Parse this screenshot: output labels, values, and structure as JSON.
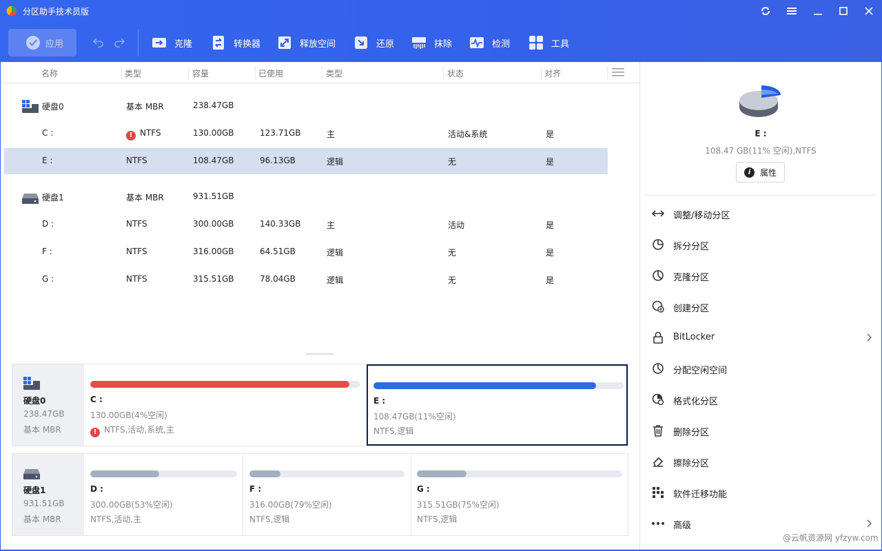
{
  "app": {
    "title": "分区助手技术员版",
    "accent_color": "#3561ea"
  },
  "toolbar": {
    "apply_label": "应用",
    "items": [
      {
        "label": "克隆",
        "icon": "clone-icon"
      },
      {
        "label": "转换器",
        "icon": "convert-icon"
      },
      {
        "label": "释放空间",
        "icon": "free-space-icon"
      },
      {
        "label": "还原",
        "icon": "restore-icon"
      },
      {
        "label": "抹除",
        "icon": "wipe-icon"
      },
      {
        "label": "检测",
        "icon": "check-icon"
      },
      {
        "label": "工具",
        "icon": "tools-icon"
      }
    ]
  },
  "table": {
    "columns": [
      "名称",
      "类型",
      "容量",
      "已使用",
      "类型",
      "状态",
      "对齐"
    ],
    "disks": [
      {
        "name": "硬盘0",
        "type": "基本 MBR",
        "capacity": "238.47GB",
        "partitions": [
          {
            "name": "C :",
            "fs": "NTFS",
            "warning": true,
            "capacity": "130.00GB",
            "used": "123.71GB",
            "kind": "主",
            "status": "活动&系统",
            "aligned": "是"
          },
          {
            "name": "E :",
            "fs": "NTFS",
            "warning": false,
            "capacity": "108.47GB",
            "used": "96.13GB",
            "kind": "逻辑",
            "status": "无",
            "aligned": "是",
            "selected": true
          }
        ]
      },
      {
        "name": "硬盘1",
        "type": "基本 MBR",
        "capacity": "931.51GB",
        "partitions": [
          {
            "name": "D :",
            "fs": "NTFS",
            "capacity": "300.00GB",
            "used": "140.33GB",
            "kind": "主",
            "status": "活动",
            "aligned": "是"
          },
          {
            "name": "F :",
            "fs": "NTFS",
            "capacity": "316.00GB",
            "used": "64.51GB",
            "kind": "逻辑",
            "status": "无",
            "aligned": "是"
          },
          {
            "name": "G :",
            "fs": "NTFS",
            "capacity": "315.51GB",
            "used": "78.04GB",
            "kind": "逻辑",
            "status": "无",
            "aligned": "是"
          }
        ]
      }
    ]
  },
  "diskmap": {
    "disk0": {
      "name": "硬盘0",
      "size": "238.47GB",
      "type": "基本 MBR",
      "parts": [
        {
          "label": "C :",
          "size": "130.00GB(4%空闲)",
          "fs": "NTFS,活动,系统,主",
          "fill": 0.96,
          "color": "#e94b4b",
          "warning": true
        },
        {
          "label": "E :",
          "size": "108.47GB(11%空闲)",
          "fs": "NTFS,逻辑",
          "fill": 0.89,
          "color": "#2f6ae0",
          "selected": true
        }
      ]
    },
    "disk1": {
      "name": "硬盘1",
      "size": "931.51GB",
      "type": "基本 MBR",
      "parts": [
        {
          "label": "D :",
          "size": "300.00GB(53%空闲)",
          "fs": "NTFS,活动,主",
          "fill": 0.47,
          "color": "#a3b0c2"
        },
        {
          "label": "F :",
          "size": "316.00GB(79%空闲)",
          "fs": "NTFS,逻辑",
          "fill": 0.2,
          "color": "#a3b0c2"
        },
        {
          "label": "G :",
          "size": "315.51GB(75%空闲)",
          "fs": "NTFS,逻辑",
          "fill": 0.24,
          "color": "#a3b0c2"
        }
      ]
    }
  },
  "sidebar": {
    "title": "E :",
    "subtitle": "108.47 GB(11% 空闲),NTFS",
    "properties_label": "属性",
    "ops": [
      {
        "label": "调整/移动分区",
        "icon": "resize-icon"
      },
      {
        "label": "拆分分区",
        "icon": "split-icon"
      },
      {
        "label": "克隆分区",
        "icon": "clone-partition-icon"
      },
      {
        "label": "创建分区",
        "icon": "create-partition-icon"
      },
      {
        "label": "BitLocker",
        "icon": "lock-icon",
        "chevron": true
      },
      {
        "label": "分配空闲空间",
        "icon": "allocate-icon"
      },
      {
        "label": "格式化分区",
        "icon": "format-icon"
      },
      {
        "label": "删除分区",
        "icon": "trash-icon"
      },
      {
        "label": "擦除分区",
        "icon": "eraser-icon"
      },
      {
        "label": "软件迁移功能",
        "icon": "apps-icon"
      },
      {
        "label": "高级",
        "icon": "more-icon",
        "chevron": true
      }
    ]
  },
  "watermark": "@云帆资源网 yfzyw.com"
}
